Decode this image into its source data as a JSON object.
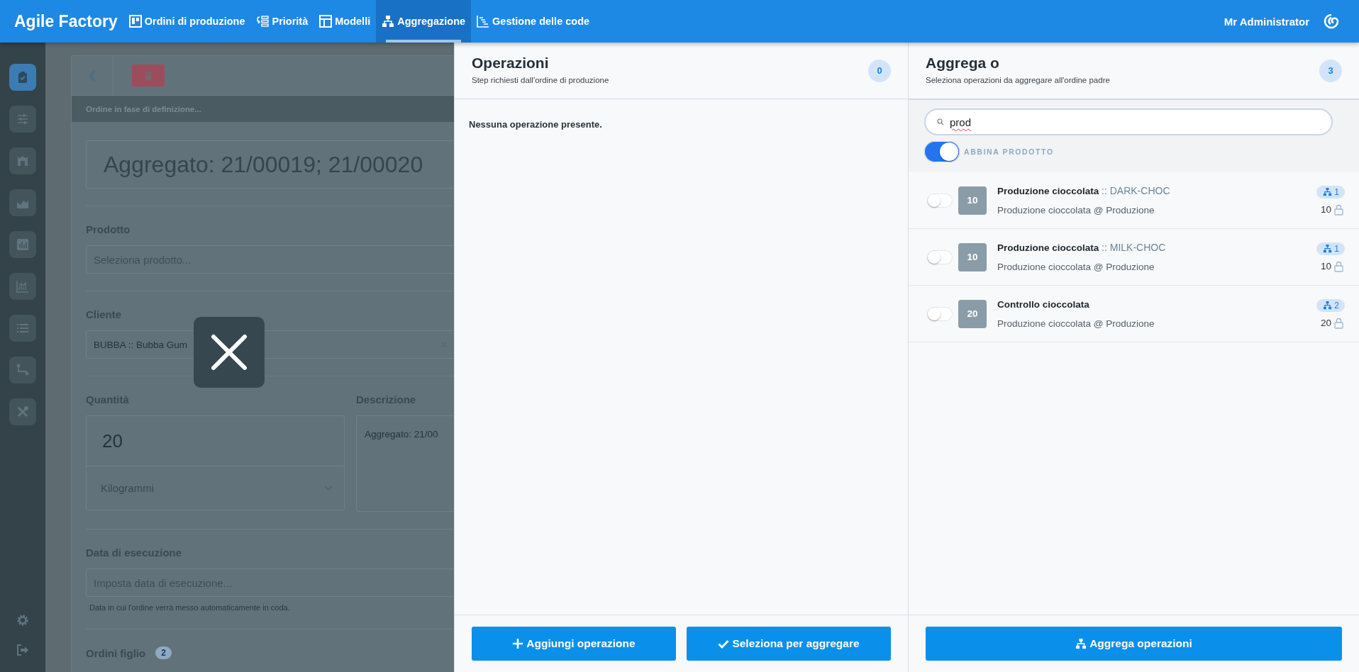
{
  "app": {
    "title": "Agile Factory"
  },
  "nav": [
    {
      "label": "Ordini di produzione",
      "kind": "board",
      "selected": false
    },
    {
      "label": "Priorità",
      "kind": "priority",
      "selected": false
    },
    {
      "label": "Modelli",
      "kind": "layout",
      "selected": false
    },
    {
      "label": "Aggregazione",
      "kind": "hierarchy",
      "selected": true
    },
    {
      "label": "Gestione delle code",
      "kind": "gantt",
      "selected": false
    }
  ],
  "user": {
    "name": "Mr Administrator"
  },
  "sidebar": {
    "items": [
      {
        "kind": "clipboard",
        "selected": true
      },
      {
        "kind": "sliders",
        "selected": false
      },
      {
        "kind": "warehouse",
        "selected": false
      },
      {
        "kind": "area",
        "selected": false
      },
      {
        "kind": "bars",
        "selected": false
      },
      {
        "kind": "linechart",
        "selected": false
      },
      {
        "kind": "list",
        "selected": false
      },
      {
        "kind": "flow",
        "selected": false
      },
      {
        "kind": "tools",
        "selected": false
      }
    ],
    "bottom": [
      {
        "kind": "settings"
      },
      {
        "kind": "logout"
      }
    ]
  },
  "order_form": {
    "status": "Ordine in fase di definizione...",
    "title": "Aggregato: 21/00019; 21/00020",
    "product": {
      "label": "Prodotto",
      "placeholder": "Seleziona prodotto..."
    },
    "customer": {
      "label": "Cliente",
      "value": "BUBBA :: Bubba Gum"
    },
    "quantity": {
      "label": "Quantità",
      "value": "20",
      "unit": "Kilogrammi"
    },
    "description": {
      "label": "Descrizione",
      "value": "Aggregato: 21/00"
    },
    "execution_date": {
      "label": "Data di esecuzione",
      "placeholder": "Imposta data di esecuzione...",
      "hint": "Data in cui l'ordine verrà messo automaticamente in coda."
    },
    "child_orders": {
      "label": "Ordini figlio",
      "count": "2"
    }
  },
  "operations_panel": {
    "title": "Operazioni",
    "subtitle": "Step richiesti dall'ordine di produzione",
    "count": "0",
    "empty_message": "Nessuna operazione presente.",
    "buttons": [
      {
        "label": "Aggiungi operazione",
        "kind": "add"
      },
      {
        "label": "Seleziona per aggregare",
        "kind": "check"
      }
    ]
  },
  "aggregate_panel": {
    "title": "Aggrega o",
    "subtitle": "Seleziona operazioni da aggregare all'ordine padre",
    "count": "3",
    "search": {
      "value": "prod"
    },
    "match_product": {
      "label": "ABBINA PRODOTTO",
      "on": true
    },
    "operations": [
      {
        "on": false,
        "number": "10",
        "name": "Produzione cioccolata",
        "code": ":: DARK-CHOC",
        "location": "Produzione cioccolata @ Produzione",
        "aggregate_count": "1",
        "quantity": "10"
      },
      {
        "on": false,
        "number": "10",
        "name": "Produzione cioccolata",
        "code": ":: MILK-CHOC",
        "location": "Produzione cioccolata @ Produzione",
        "aggregate_count": "1",
        "quantity": "10"
      },
      {
        "on": false,
        "number": "20",
        "name": "Controllo cioccolata",
        "location": "Produzione cioccolata @ Produzione",
        "aggregate_count": "2",
        "quantity": "20"
      }
    ],
    "button": {
      "label": "Aggrega operazioni"
    }
  }
}
